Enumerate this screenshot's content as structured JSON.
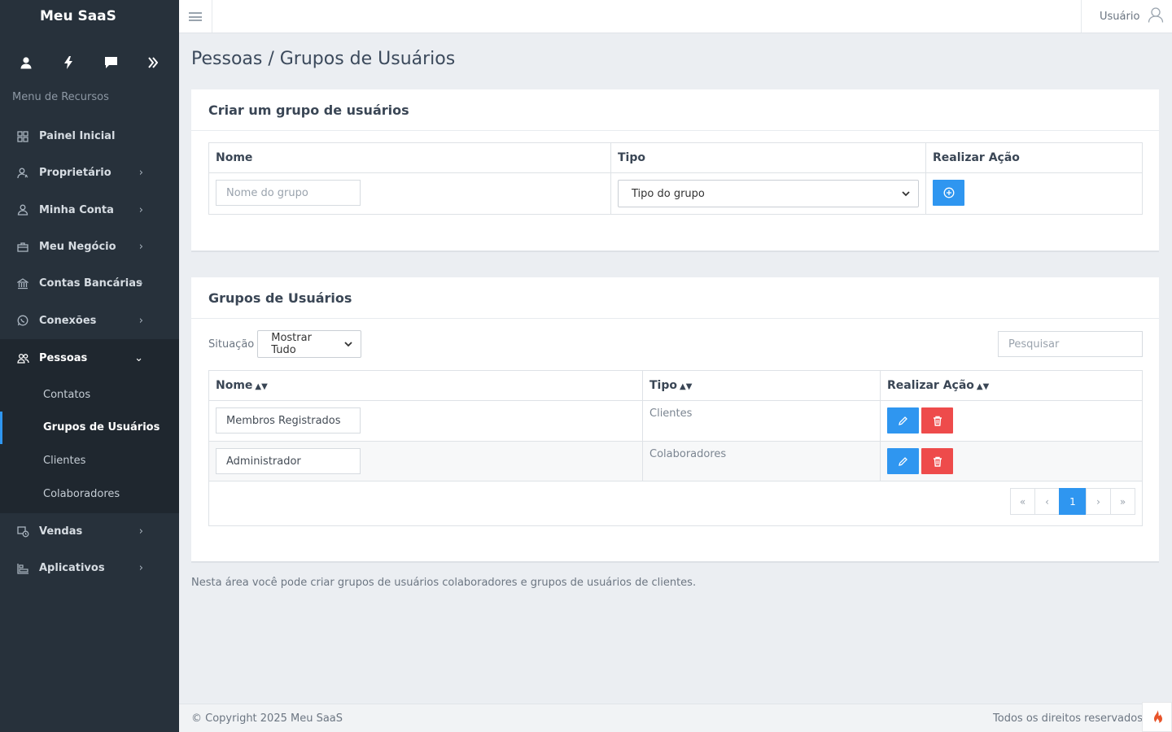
{
  "app": {
    "brand": "Meu SaaS"
  },
  "sidebar": {
    "quick_icons": [
      "user-icon",
      "bolt-icon",
      "chat-icon",
      "double-chevron-right-icon"
    ],
    "menu_title": "Menu de Recursos",
    "items": [
      {
        "label": "Painel Inicial",
        "icon": "dashboard-icon"
      },
      {
        "label": "Proprietário",
        "icon": "owner-icon"
      },
      {
        "label": "Minha Conta",
        "icon": "account-icon"
      },
      {
        "label": "Meu Negócio",
        "icon": "briefcase-icon"
      },
      {
        "label": "Contas Bancárias",
        "icon": "bank-icon"
      },
      {
        "label": "Conexões",
        "icon": "whatsapp-icon"
      },
      {
        "label": "Pessoas",
        "icon": "people-icon"
      },
      {
        "label": "Vendas",
        "icon": "sales-icon"
      },
      {
        "label": "Aplicativos",
        "icon": "apps-icon"
      }
    ],
    "submenu": [
      {
        "label": "Contatos"
      },
      {
        "label": "Grupos de Usuários"
      },
      {
        "label": "Clientes"
      },
      {
        "label": "Colaboradores"
      }
    ]
  },
  "topbar": {
    "user_label": "Usuário"
  },
  "page": {
    "title": "Pessoas / Grupos de Usuários"
  },
  "create_card": {
    "title": "Criar um grupo de usuários",
    "headers": {
      "name": "Nome",
      "type": "Tipo",
      "action": "Realizar Ação"
    },
    "name_placeholder": "Nome do grupo",
    "type_placeholder": "Tipo do grupo"
  },
  "groups_card": {
    "title": "Grupos de Usuários",
    "filter_label": "Situação",
    "filter_value": "Mostrar Tudo",
    "search_placeholder": "Pesquisar",
    "headers": {
      "name": "Nome",
      "type": "Tipo",
      "action": "Realizar Ação"
    },
    "rows": [
      {
        "name": "Membros Registrados",
        "type": "Clientes"
      },
      {
        "name": "Administrador",
        "type": "Colaboradores"
      }
    ],
    "pagination": {
      "first": "«",
      "prev": "‹",
      "current": "1",
      "next": "›",
      "last": "»"
    }
  },
  "note": "Nesta área você pode criar grupos de usuários colaboradores e grupos de usuários de clientes.",
  "footer": {
    "left": "© Copyright 2025 Meu SaaS",
    "right": "Todos os direitos reservados"
  },
  "colors": {
    "accent": "#2f96f0",
    "danger": "#ee4b4b",
    "sidebar": "#27313b"
  }
}
